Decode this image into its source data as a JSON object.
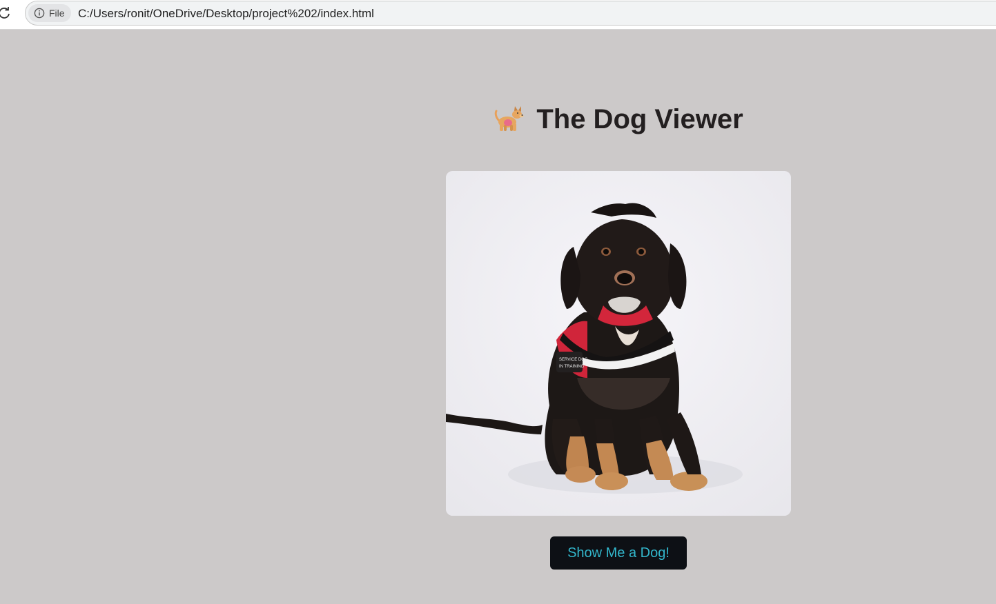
{
  "browser": {
    "chip_icon": "info-icon",
    "chip_label": "File",
    "url": "C:/Users/ronit/OneDrive/Desktop/project%202/index.html"
  },
  "page": {
    "title_icon": "dog-emoji",
    "title": "The Dog Viewer",
    "image_subject": "dog-photo",
    "button_label": "Show Me a Dog!"
  },
  "colors": {
    "page_background": "#ccc9c9",
    "button_background": "#0d1015",
    "button_text": "#32b6cb",
    "title_text": "#231f20"
  }
}
